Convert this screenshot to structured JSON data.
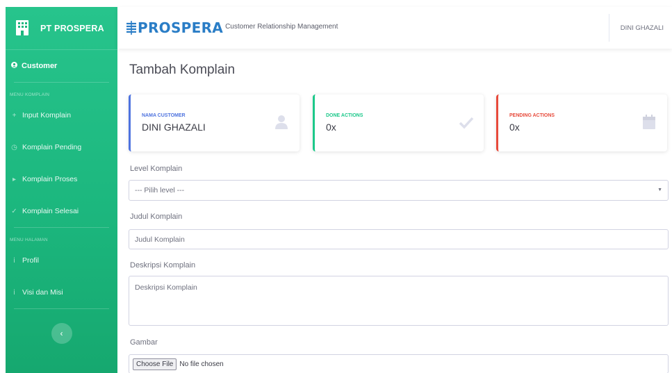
{
  "sidebar": {
    "brand": "PT PROSPERA",
    "active_item": "Customer",
    "heading_1": "MENU KOMPLAIN",
    "items_1": [
      {
        "icon": "plus-icon",
        "label": "Input Komplain"
      },
      {
        "icon": "clock-icon",
        "label": "Komplain Pending"
      },
      {
        "icon": "play-icon",
        "label": "Komplain Proses"
      },
      {
        "icon": "check-icon",
        "label": "Komplain Selesai"
      }
    ],
    "heading_2": "MENU HALAMAN",
    "items_2": [
      {
        "icon": "info-icon",
        "label": "Profil"
      },
      {
        "icon": "info-icon",
        "label": "Visi dan Misi"
      }
    ],
    "toggle": "‹"
  },
  "topbar": {
    "logo_text": "PROSPERA",
    "logo_sub": "Customer Relationship Management",
    "user": "DINI GHAZALI"
  },
  "main": {
    "title": "Tambah Komplain",
    "cards": [
      {
        "label": "NAMA CUSTOMER",
        "value": "DINI GHAZALI",
        "icon": "user-icon"
      },
      {
        "label": "DONE ACTIONS",
        "value": "0x",
        "icon": "check-icon"
      },
      {
        "label": "PENDING ACTIONS",
        "value": "0x",
        "icon": "calendar-icon"
      }
    ],
    "form": {
      "level_label": "Level Komplain",
      "level_value": "--- Pilih level ---",
      "judul_label": "Judul Komplain",
      "judul_placeholder": "Judul Komplain",
      "deskripsi_label": "Deskripsi Komplain",
      "deskripsi_placeholder": "Deskripsi Komplain",
      "gambar_label": "Gambar",
      "file_button": "Choose File",
      "file_status": "No file chosen"
    }
  },
  "colors": {
    "sidebar": "#1cb77e",
    "primary": "#4e73df",
    "success": "#1cc88a",
    "danger": "#e74a3b",
    "logo": "#2a7dc6"
  }
}
